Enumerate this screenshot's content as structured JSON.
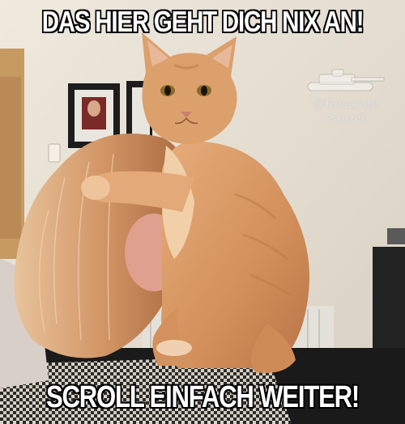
{
  "meme": {
    "top_caption": "DAS HIER GEHT DICH NIX AN!",
    "bottom_caption": "SCROLL EINFACH WEITER!"
  },
  "watermark": {
    "line1": "@Rosarote",
    "line2": "Panzer",
    "icon": "tank-icon"
  },
  "colors": {
    "caption_text": "#ffffff",
    "caption_outline": "#000000",
    "cat_fur": "#d89a67",
    "hair": "#d9a070",
    "wall": "#e9e2d4"
  }
}
